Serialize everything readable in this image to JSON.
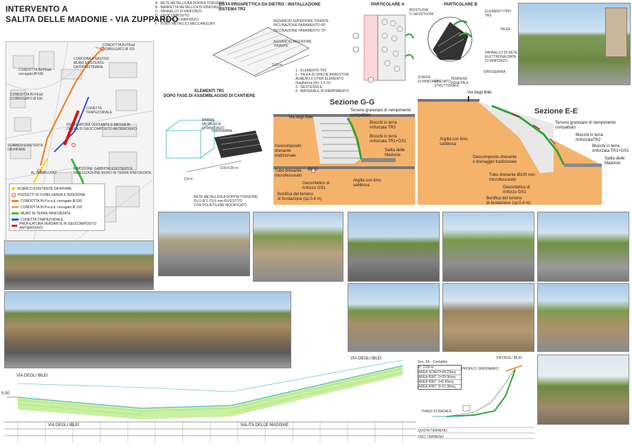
{
  "title": {
    "line1": "INTERVENTO  A",
    "line2": "SALITA DELLE MADONIE - VIA ZUPPARDO"
  },
  "map": {
    "labels": [
      "CONDOTTA IN PEad\nCORRUGATO Ø 315",
      "CORDONA A NASTRO\nMURO ESISTENTE\nDA RIPRISTINARE",
      "CONDOTTA IN PEad\ncorrugato Ø 630",
      "CONDOTTA IN PEad\nCORRUGATO Ø 630",
      "CUNETTA\nTRAPEZOIDALE",
      "PROFILATURA VERSANTE E MESSA IN\nOPERA DI GEOCOMPOSITO ANTIEROSIVO",
      "SCARICO ESISTENTE\nDA RIFARE",
      "AL COMPLUVIO",
      "RIMOZIONE GABBIONI ESISTENTI E\nREALIZZAZIONE MURO IN TERRA RINFORZATA"
    ],
    "legend": [
      {
        "label": "SCARICO ESISTENTE DA RIFARE",
        "color": "#f5d000"
      },
      {
        "label": "POZZETTI DI CONFLUENZA E ISPEZIONE",
        "color": "#e04040"
      },
      {
        "label": "CONDOTTA IN P.e.a.d. corrugato Ø 630",
        "color": "#f08020"
      },
      {
        "label": "CONDOTTA IN P.e.a.d. corrugato Ø 315",
        "color": "#f0a060"
      },
      {
        "label": "MURO IN TERRE RINFORZATE",
        "color": "#30c030"
      },
      {
        "label": "CUNETTA TRAPEZOIDALE",
        "color": "#3050e0"
      },
      {
        "label": "PROFILATURA VERSANTE IN GEOCOMPOSITO ANTIEROSIVO",
        "color": "#e01010"
      }
    ]
  },
  "top": {
    "vista_title": "VISTA PROSPETTICA DA DIETRO - INSTALLAZIONE\nSISTEMA TR2",
    "particolare_a": "PARTICOLARE A",
    "particolare_b": "PARTICOLARE B",
    "elementi_title": "ELEMENTI TR1\nDOPO FASE DI ASSEMBLAGGIO DI CANTIERE",
    "legend_numbers": "1 - ELEMENTO TR2\n2 - TALEA DI SPECIE ARBUSTIVA\nALMENO 2-3 PER ELEMENTO\n(lunghezza min. 1.5 m)\n3 - GEOTESSILE\n4 - MATERIALE DI RIEMPIMENTO",
    "dim_300": "3.00 m",
    "barra_metallica": "BARRA\nMETALLICA\nDI RINFORZO",
    "diaframma": "DIAFRAMMA",
    "rete_metallica": "RETE METALLICA A DOPPIA TORSIONE\nFILO Ø 2.7/3.5 mm RIVESTITO\nCON POLIETILENE MODIFICATO",
    "dim_08": "0.8 m",
    "dim_300_600": "3.00-6.00 m",
    "biostuoia": "BIOSTUOIA\nO GEOSTUOIA",
    "staffe": "STAFFE\nDI RINFORZO",
    "rilevato": "RILEVATO\nSTRUTTURALE",
    "terreno_vegetale": "TERRENO\nVEGETALE",
    "idrosemina": "IDROSEMINA",
    "elementi_tr2": "ELEMENTI TIPO\nTR2",
    "talee": "TALEE",
    "pannello": "PANNELLO DI RETE\nELETTROSALDATA\nDI RINFORZO",
    "aggancio_sup": "AGGANCIO SUPERIORE TIRANTE\nINCLINAZIONE PARAMENTO 60°",
    "inclinazione70": "INCLINAZIONE PARAMENTO 70°",
    "aggancio_inf": "AGGANCIO INFERIORE\nTIRANTE",
    "left_notes": "A - RETE METALLICA A DOPPIA TORSIONE\nB - BARRETTA METALLICA DI RINFORZO\nC - PANNELLO DI RINFORZO\nD - GEOCOMPOSITO\nE - TIRANTE DI RINFORZO\nF - PUNTI METALLICI MECCANIZZATI"
  },
  "sezione_gg": {
    "title": "Sezione G-G",
    "via": "Via degli Iblei",
    "labels": [
      "Terreno granulare di riempimento\ncompattato",
      "Blocchi in terra\nrinforzata TR2",
      "Blocchi in terra\nrinforzata TR1+GS1",
      "Salita delle\nMadonie",
      "Geocomposito\ndrenante\ntradizionale",
      "Tubo drenante\nmicrofessurato",
      "Ø100",
      "Geosintetico di\nrinforzo GS1",
      "Argilla con limo\nsabbiosa",
      "Bonifica del terreno\ndi fondazione (sp.0.4 m)"
    ]
  },
  "sezione_ee": {
    "title": "Sezione E-E",
    "via": "Via degli Iblei",
    "labels": [
      "Terreno granulare di riempimento\ncompattato",
      "Blocchi in terra\nrinforzataTR2",
      "Blocchi in terra\nrinforzata TR1+GS1",
      "Salita delle\nMadonie",
      "Argilla con limo\nsabbiosa",
      "Geocomposito drenante\no drenaggio tradizionale",
      "Tubo drenante Ø100 mm\nmicrofessurato",
      "Geosintetico di\nrinforzo GS1",
      "Bonifica del terreno\ndi fondazione (sp.0.4 m)"
    ]
  },
  "profile": {
    "via_top": "VIA DEGLI IBLEI",
    "via_left": "VIA DEGLI IBLEI",
    "salita": "SALITA DELLE MADONIE",
    "via_bottom": "VIA DEGLI IBLEI",
    "scale_zero": "0.00"
  },
  "section_small": {
    "sez": "Sez. S6 - Contabile",
    "table": [
      "P.: 0.00 m",
      "AREA SCAVO=36.23mq",
      "AREA RINT. 1=29.96mq",
      "AREA RINT. 2=5.95mq",
      "AREA RINT. 3=10.38mq"
    ],
    "profilo": "PROFILO ORIGINARIO",
    "via": "VIA DEGLI IBLEI",
    "piano": "PIANO STRADALE",
    "quote": [
      "QUOTA TERRENO",
      "DIST. TERRENO"
    ]
  },
  "colors": {
    "soil": "#f5b26a",
    "soil_light": "#f8c98f",
    "green": "#2fa33a",
    "sky": "#9cc6ea",
    "asphalt": "#8a8a8a",
    "profile_fill": "#c8f0a0",
    "profile_line": "#3ab0c8"
  }
}
